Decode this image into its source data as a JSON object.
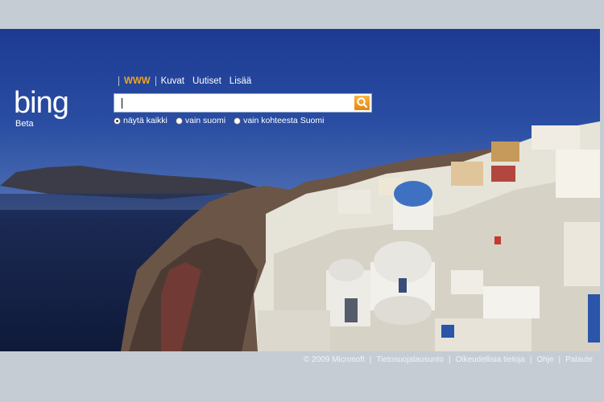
{
  "logo": {
    "text": "bing",
    "subtitle": "Beta"
  },
  "nav": {
    "items": [
      {
        "label": "WWW",
        "active": true
      },
      {
        "label": "Kuvat"
      },
      {
        "label": "Uutiset"
      },
      {
        "label": "Lisää"
      }
    ]
  },
  "search": {
    "value": "",
    "icon": "search-icon",
    "button_color": "#f0a020"
  },
  "scope": {
    "options": [
      {
        "label": "näytä kaikki",
        "selected": true
      },
      {
        "label": "vain suomi"
      },
      {
        "label": "vain kohteesta Suomi"
      }
    ]
  },
  "footer": {
    "links": [
      "© 2009 Microsoft",
      "Tietosuojalausunto",
      "Oikeudellisia tietoja",
      "Ohje",
      "Palaute"
    ],
    "separator": "|"
  },
  "colors": {
    "nav_active": "#f3a51d",
    "sky_top": "#1d3a93",
    "sea": "#15244a"
  }
}
